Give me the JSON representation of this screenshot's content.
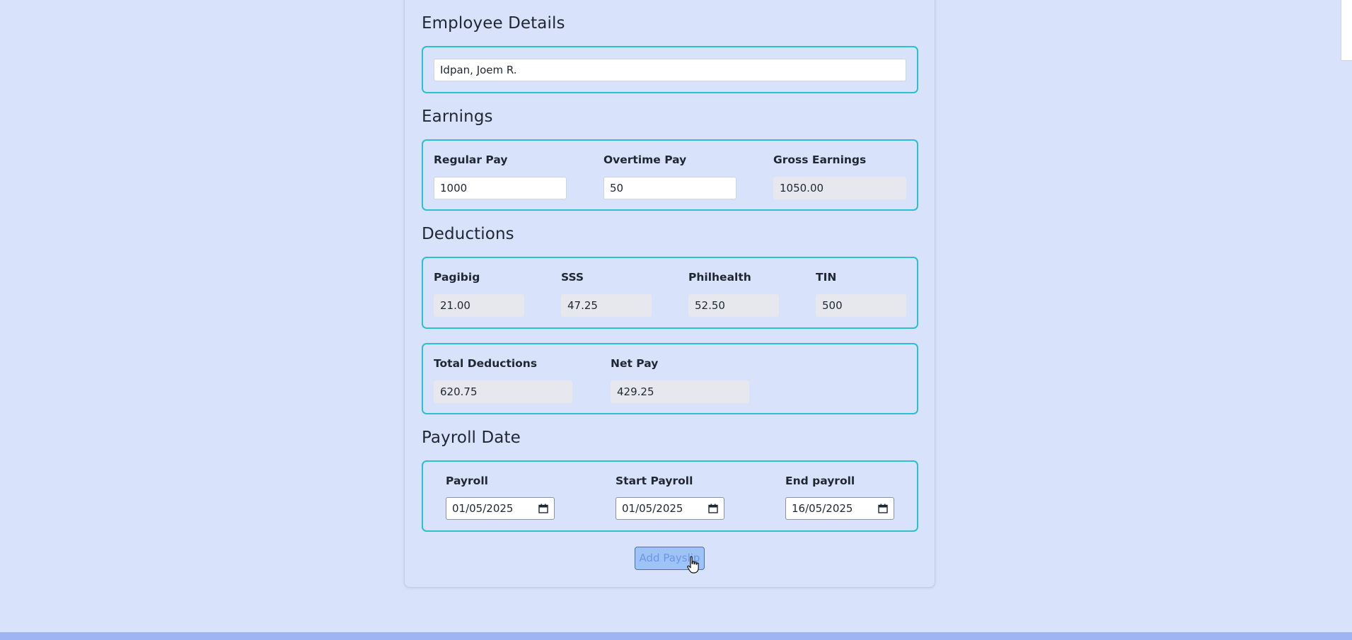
{
  "employee_section": {
    "title": "Employee Details",
    "employee_name": "Idpan, Joem R."
  },
  "earnings_section": {
    "title": "Earnings",
    "regular_pay": {
      "label": "Regular Pay",
      "value": "1000"
    },
    "overtime_pay": {
      "label": "Overtime Pay",
      "value": "50"
    },
    "gross_earnings": {
      "label": "Gross Earnings",
      "value": "1050.00"
    }
  },
  "deductions_section": {
    "title": "Deductions",
    "pagibig": {
      "label": "Pagibig",
      "value": "21.00"
    },
    "sss": {
      "label": "SSS",
      "value": "47.25"
    },
    "philhealth": {
      "label": "Philhealth",
      "value": "52.50"
    },
    "tin": {
      "label": "TIN",
      "value": "500"
    }
  },
  "totals_section": {
    "total_deductions": {
      "label": "Total Deductions",
      "value": "620.75"
    },
    "net_pay": {
      "label": "Net Pay",
      "value": "429.25"
    }
  },
  "payroll_date_section": {
    "title": "Payroll Date",
    "payroll": {
      "label": "Payroll",
      "value": "01/05/2025"
    },
    "start_payroll": {
      "label": "Start Payroll",
      "value": "01/05/2025"
    },
    "end_payroll": {
      "label": "End payroll",
      "value": "16/05/2025"
    }
  },
  "actions": {
    "add_payslip_label": "Add Payslip"
  },
  "colors": {
    "page_background": "#d9e2fb",
    "fieldset_border": "#2bbfcf",
    "button_background": "#9fc2f7",
    "button_border": "#3d6fd6"
  }
}
